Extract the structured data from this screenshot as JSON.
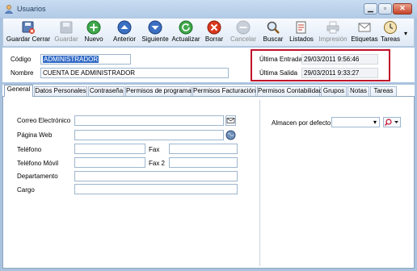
{
  "window": {
    "title": "Usuarios",
    "controls": {
      "minimize": "▁",
      "maximize": "▫",
      "close": "✕"
    }
  },
  "toolbar": {
    "items": [
      {
        "label": "Guardar Cerrar",
        "icon": "save-close-icon",
        "enabled": true
      },
      {
        "label": "Guardar",
        "icon": "save-icon",
        "enabled": false
      },
      {
        "label": "Nuevo",
        "icon": "plus-icon",
        "enabled": true
      },
      {
        "label": "Anterior",
        "icon": "arrow-up-icon",
        "enabled": true
      },
      {
        "label": "Siguiente",
        "icon": "arrow-down-icon",
        "enabled": true
      },
      {
        "label": "Actualizar",
        "icon": "refresh-icon",
        "enabled": true
      },
      {
        "label": "Borrar",
        "icon": "delete-icon",
        "enabled": true
      },
      {
        "label": "Cancelar",
        "icon": "cancel-icon",
        "enabled": false
      },
      {
        "label": "Buscar",
        "icon": "magnifier-icon",
        "enabled": true
      },
      {
        "label": "Listados",
        "icon": "reports-icon",
        "enabled": true
      },
      {
        "label": "Impresión",
        "icon": "printer-icon",
        "enabled": false
      },
      {
        "label": "Etiquetas",
        "icon": "envelope-icon",
        "enabled": true
      },
      {
        "label": "Tareas",
        "icon": "clock-icon",
        "enabled": true
      }
    ],
    "overflow_glyph": "▾"
  },
  "header": {
    "codigo_label": "Código",
    "codigo_value": "ADMINISTRADOR",
    "nombre_label": "Nombre",
    "nombre_value": "CUENTA DE ADMINISTRADOR",
    "ultima_entrada_label": "Última Entrada",
    "ultima_entrada_value": "29/03/2011 9:56:46",
    "ultima_salida_label": "Última Salida",
    "ultima_salida_value": "29/03/2011 9:33:27"
  },
  "tabs": [
    {
      "label": "General",
      "active": true
    },
    {
      "label": "Datos Personales",
      "active": false
    },
    {
      "label": "Contraseña",
      "active": false
    },
    {
      "label": "Permisos de programa",
      "active": false
    },
    {
      "label": "Permisos Facturación",
      "active": false
    },
    {
      "label": "Permisos Contabilidad",
      "active": false
    },
    {
      "label": "Grupos",
      "active": false
    },
    {
      "label": "Notas",
      "active": false
    },
    {
      "label": "Tareas",
      "active": false
    }
  ],
  "general": {
    "correo_label": "Correo Electrónico",
    "correo_value": "",
    "web_label": "Página Web",
    "web_value": "",
    "telefono_label": "Teléfono",
    "telefono_value": "",
    "fax_label": "Fax",
    "fax_value": "",
    "movil_label": "Teléfono Móvil",
    "movil_value": "",
    "fax2_label": "Fax 2",
    "fax2_value": "",
    "departamento_label": "Departamento",
    "departamento_value": "",
    "cargo_label": "Cargo",
    "cargo_value": "",
    "almacen_label": "Almacen por defecto",
    "almacen_value": "",
    "dropdown_glyph": "▾"
  },
  "colors": {
    "highlight_box": "#c0102a",
    "selection": "#316ac5",
    "window_frame": "#a9c3df"
  }
}
